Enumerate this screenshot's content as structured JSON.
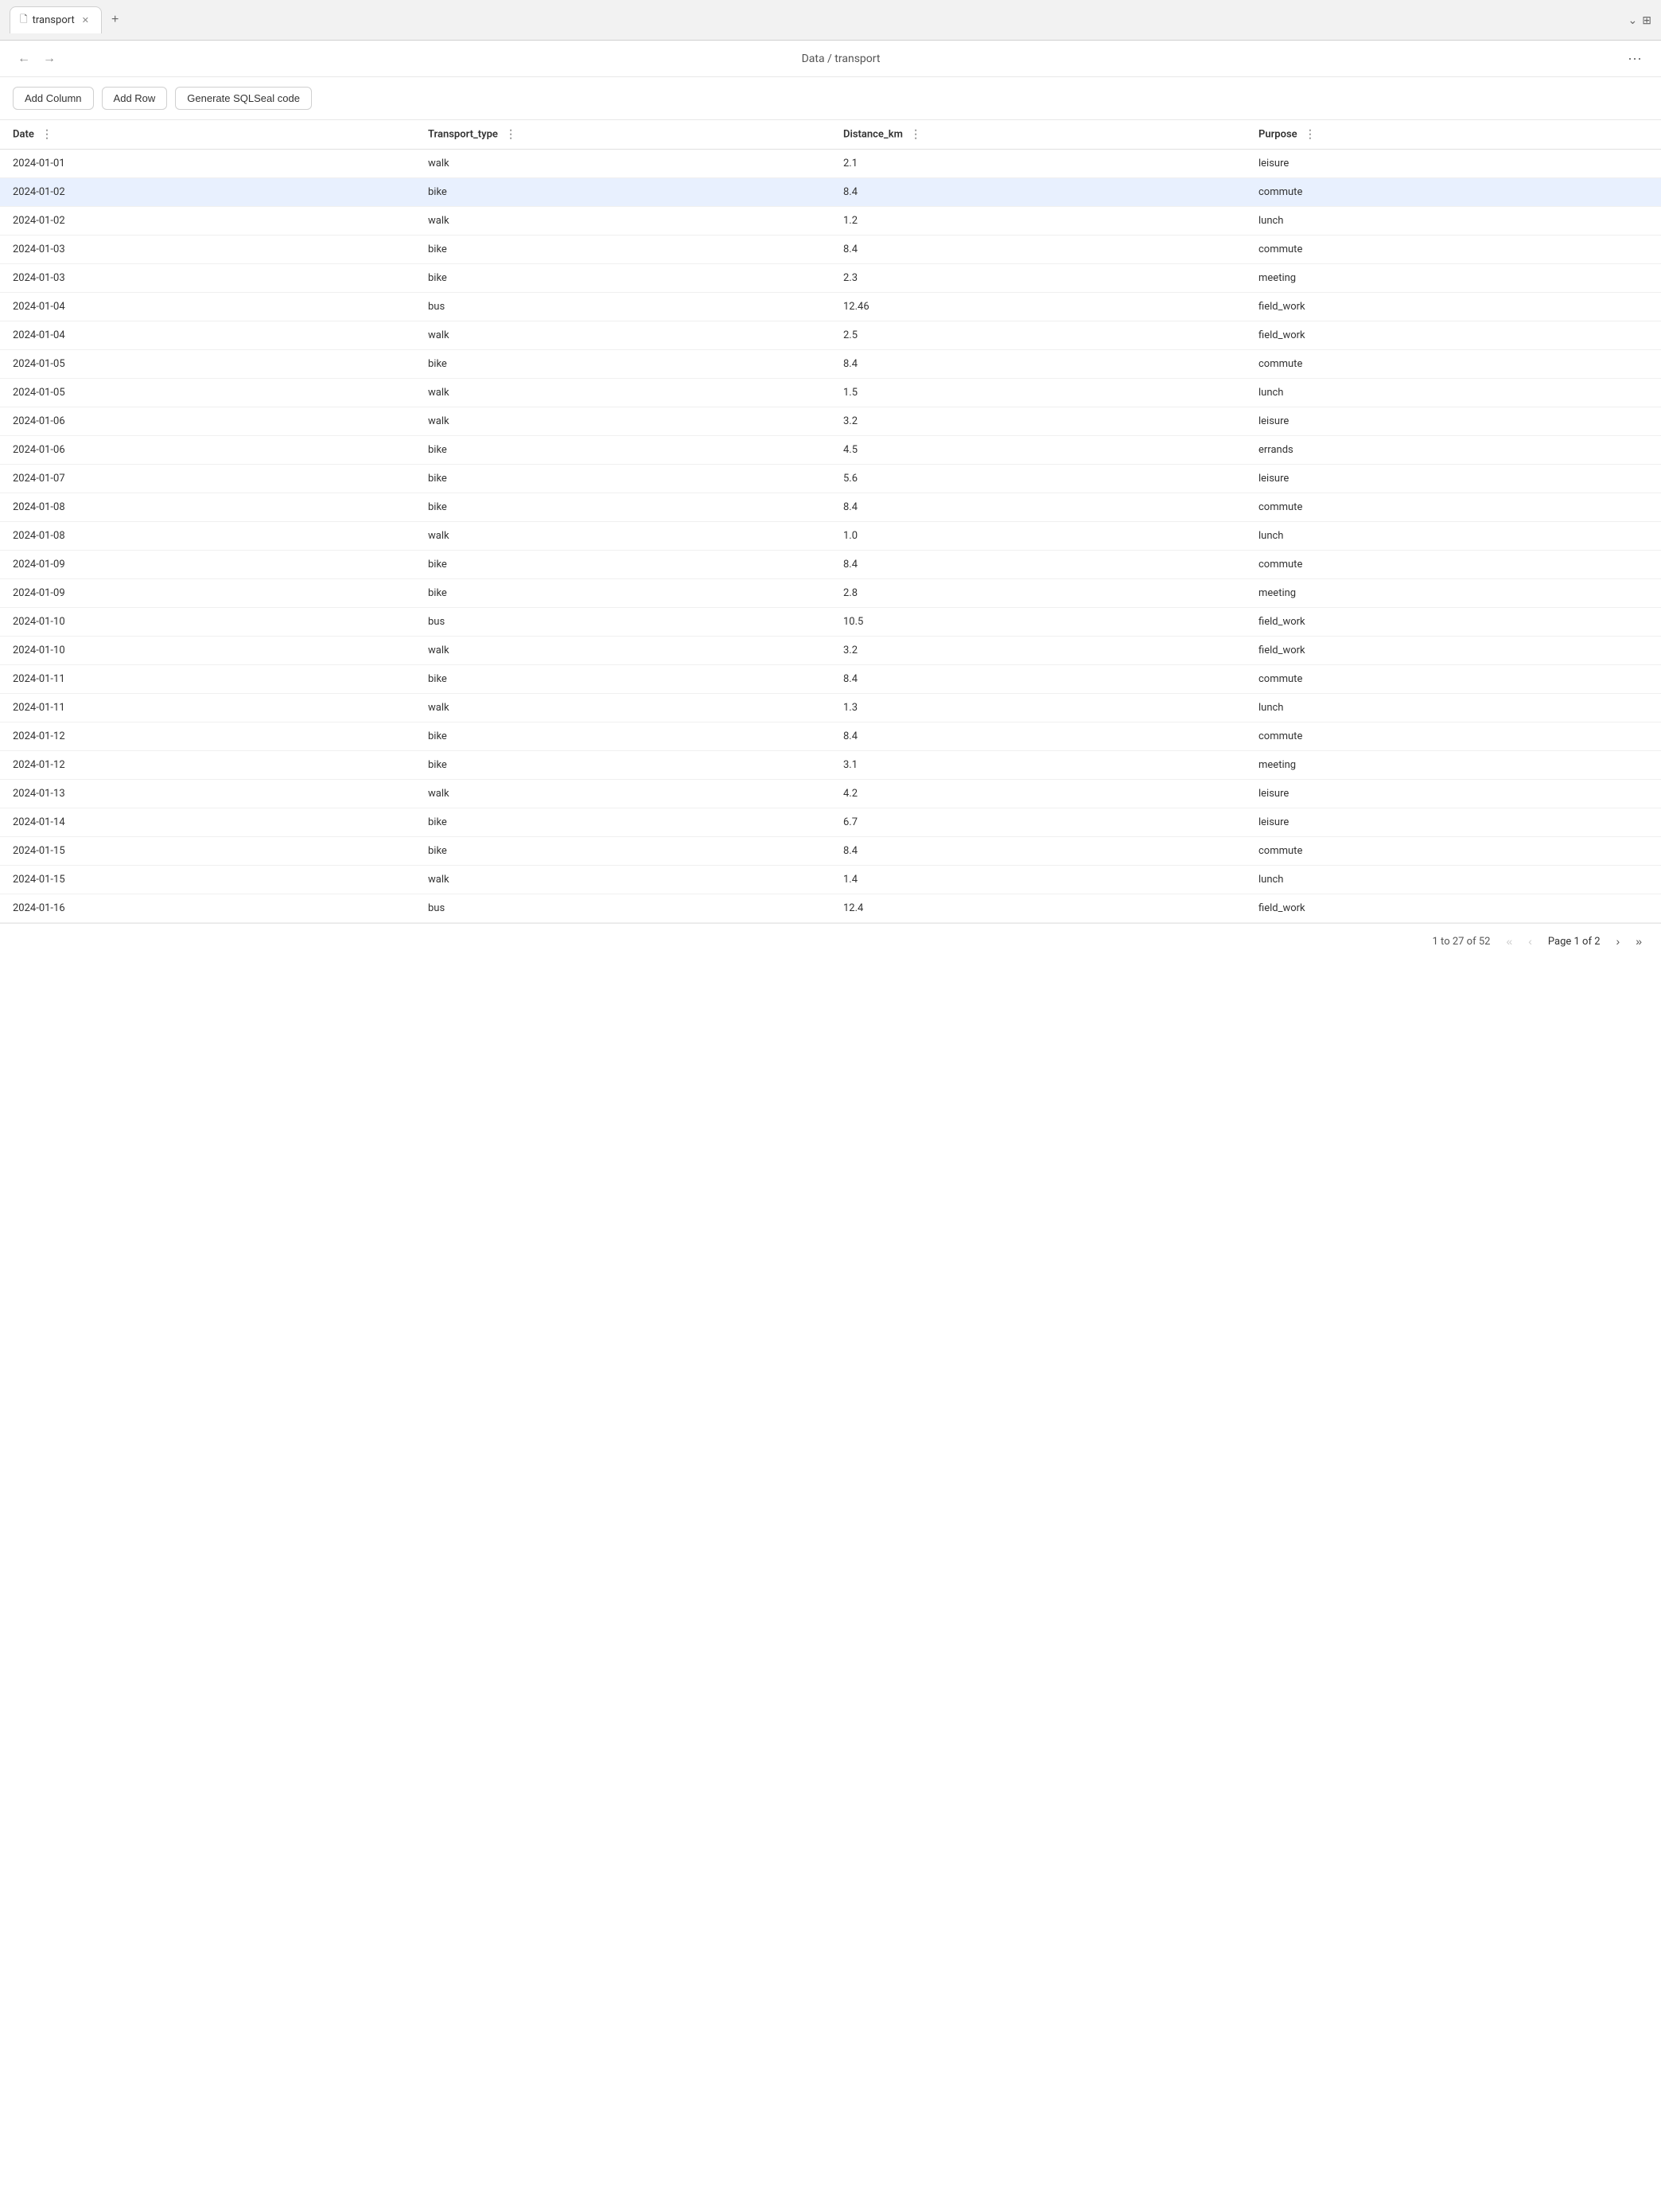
{
  "browser": {
    "tab_label": "transport",
    "tab_icon": "📄",
    "new_tab_icon": "+",
    "controls_more": "⌄",
    "controls_grid": "⊞"
  },
  "nav": {
    "back_arrow": "←",
    "forward_arrow": "→",
    "breadcrumb": "Data / transport",
    "more_icon": "···"
  },
  "toolbar": {
    "add_column": "Add Column",
    "add_row": "Add Row",
    "generate_sql": "Generate SQLSeal code"
  },
  "columns": [
    {
      "key": "date",
      "label": "Date"
    },
    {
      "key": "transport_type",
      "label": "Transport_type"
    },
    {
      "key": "distance_km",
      "label": "Distance_km"
    },
    {
      "key": "purpose",
      "label": "Purpose"
    }
  ],
  "rows": [
    {
      "date": "2024-01-01",
      "transport_type": "walk",
      "distance_km": "2.1",
      "purpose": "leisure",
      "selected": false
    },
    {
      "date": "2024-01-02",
      "transport_type": "bike",
      "distance_km": "8.4",
      "purpose": "commute",
      "selected": true
    },
    {
      "date": "2024-01-02",
      "transport_type": "walk",
      "distance_km": "1.2",
      "purpose": "lunch",
      "selected": false
    },
    {
      "date": "2024-01-03",
      "transport_type": "bike",
      "distance_km": "8.4",
      "purpose": "commute",
      "selected": false
    },
    {
      "date": "2024-01-03",
      "transport_type": "bike",
      "distance_km": "2.3",
      "purpose": "meeting",
      "selected": false
    },
    {
      "date": "2024-01-04",
      "transport_type": "bus",
      "distance_km": "12.46",
      "purpose": "field_work",
      "selected": false
    },
    {
      "date": "2024-01-04",
      "transport_type": "walk",
      "distance_km": "2.5",
      "purpose": "field_work",
      "selected": false
    },
    {
      "date": "2024-01-05",
      "transport_type": "bike",
      "distance_km": "8.4",
      "purpose": "commute",
      "selected": false
    },
    {
      "date": "2024-01-05",
      "transport_type": "walk",
      "distance_km": "1.5",
      "purpose": "lunch",
      "selected": false
    },
    {
      "date": "2024-01-06",
      "transport_type": "walk",
      "distance_km": "3.2",
      "purpose": "leisure",
      "selected": false
    },
    {
      "date": "2024-01-06",
      "transport_type": "bike",
      "distance_km": "4.5",
      "purpose": "errands",
      "selected": false
    },
    {
      "date": "2024-01-07",
      "transport_type": "bike",
      "distance_km": "5.6",
      "purpose": "leisure",
      "selected": false
    },
    {
      "date": "2024-01-08",
      "transport_type": "bike",
      "distance_km": "8.4",
      "purpose": "commute",
      "selected": false
    },
    {
      "date": "2024-01-08",
      "transport_type": "walk",
      "distance_km": "1.0",
      "purpose": "lunch",
      "selected": false
    },
    {
      "date": "2024-01-09",
      "transport_type": "bike",
      "distance_km": "8.4",
      "purpose": "commute",
      "selected": false
    },
    {
      "date": "2024-01-09",
      "transport_type": "bike",
      "distance_km": "2.8",
      "purpose": "meeting",
      "selected": false
    },
    {
      "date": "2024-01-10",
      "transport_type": "bus",
      "distance_km": "10.5",
      "purpose": "field_work",
      "selected": false
    },
    {
      "date": "2024-01-10",
      "transport_type": "walk",
      "distance_km": "3.2",
      "purpose": "field_work",
      "selected": false
    },
    {
      "date": "2024-01-11",
      "transport_type": "bike",
      "distance_km": "8.4",
      "purpose": "commute",
      "selected": false
    },
    {
      "date": "2024-01-11",
      "transport_type": "walk",
      "distance_km": "1.3",
      "purpose": "lunch",
      "selected": false
    },
    {
      "date": "2024-01-12",
      "transport_type": "bike",
      "distance_km": "8.4",
      "purpose": "commute",
      "selected": false
    },
    {
      "date": "2024-01-12",
      "transport_type": "bike",
      "distance_km": "3.1",
      "purpose": "meeting",
      "selected": false
    },
    {
      "date": "2024-01-13",
      "transport_type": "walk",
      "distance_km": "4.2",
      "purpose": "leisure",
      "selected": false
    },
    {
      "date": "2024-01-14",
      "transport_type": "bike",
      "distance_km": "6.7",
      "purpose": "leisure",
      "selected": false
    },
    {
      "date": "2024-01-15",
      "transport_type": "bike",
      "distance_km": "8.4",
      "purpose": "commute",
      "selected": false
    },
    {
      "date": "2024-01-15",
      "transport_type": "walk",
      "distance_km": "1.4",
      "purpose": "lunch",
      "selected": false
    },
    {
      "date": "2024-01-16",
      "transport_type": "bus",
      "distance_km": "12.4",
      "purpose": "field_work",
      "selected": false
    }
  ],
  "pagination": {
    "range_text": "1 to 27 of 52",
    "page_text": "Page 1 of 2",
    "first_btn": "«",
    "prev_btn": "‹",
    "next_btn": "›",
    "last_btn": "»"
  }
}
